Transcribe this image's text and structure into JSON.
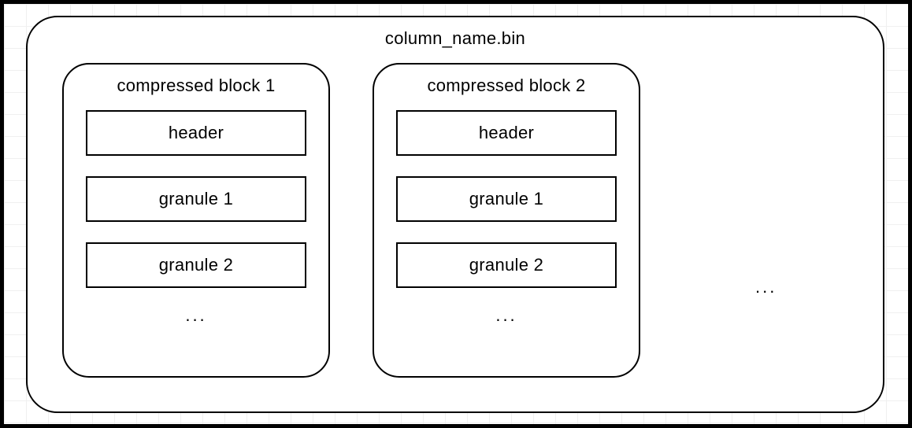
{
  "container": {
    "title": "column_name.bin"
  },
  "blocks": [
    {
      "title": "compressed block 1",
      "cells": [
        "header",
        "granule 1",
        "granule 2"
      ],
      "ellipsis": "..."
    },
    {
      "title": "compressed block 2",
      "cells": [
        "header",
        "granule 1",
        "granule 2"
      ],
      "ellipsis": "..."
    }
  ],
  "trailing_ellipsis": "..."
}
